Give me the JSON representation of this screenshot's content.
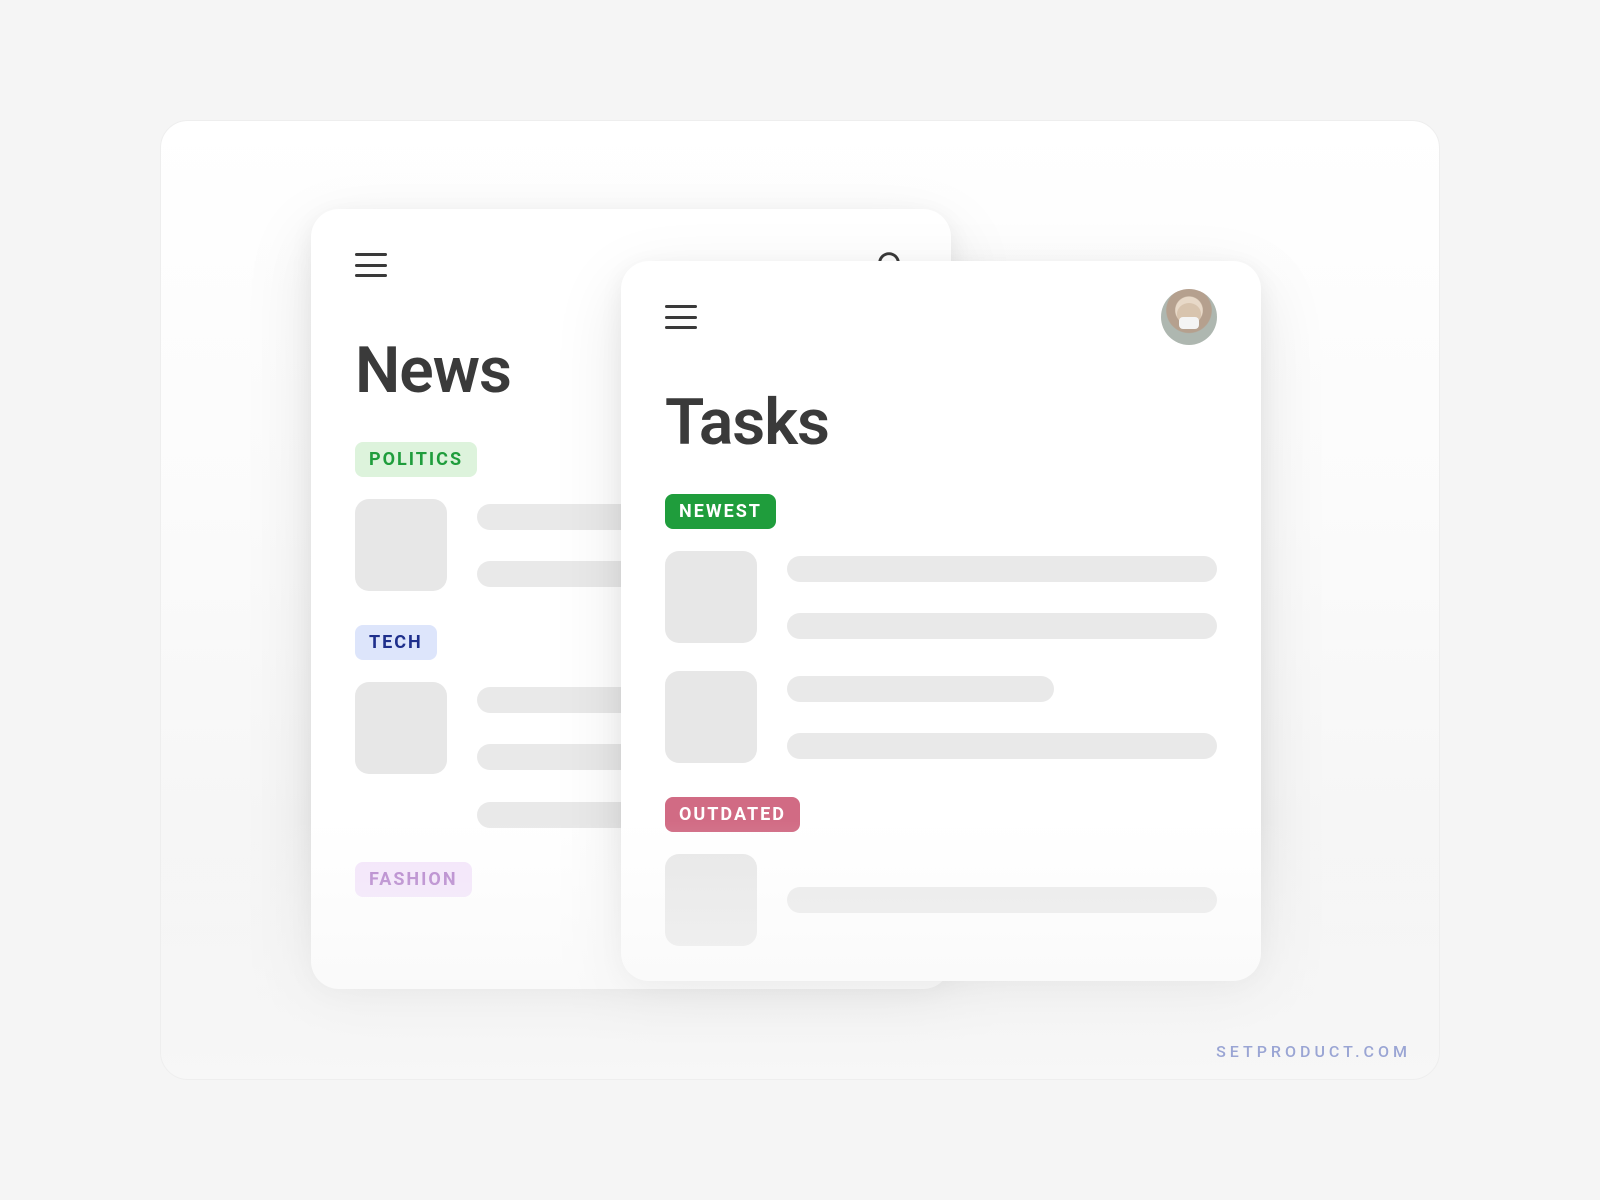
{
  "watermark": "SETPRODUCT.COM",
  "news_card": {
    "title": "News",
    "tags": {
      "politics": "POLITICS",
      "tech": "TECH",
      "fashion": "FASHION"
    }
  },
  "tasks_card": {
    "title": "Tasks",
    "tags": {
      "newest": "NEWEST",
      "outdated": "OUTDATED"
    }
  }
}
